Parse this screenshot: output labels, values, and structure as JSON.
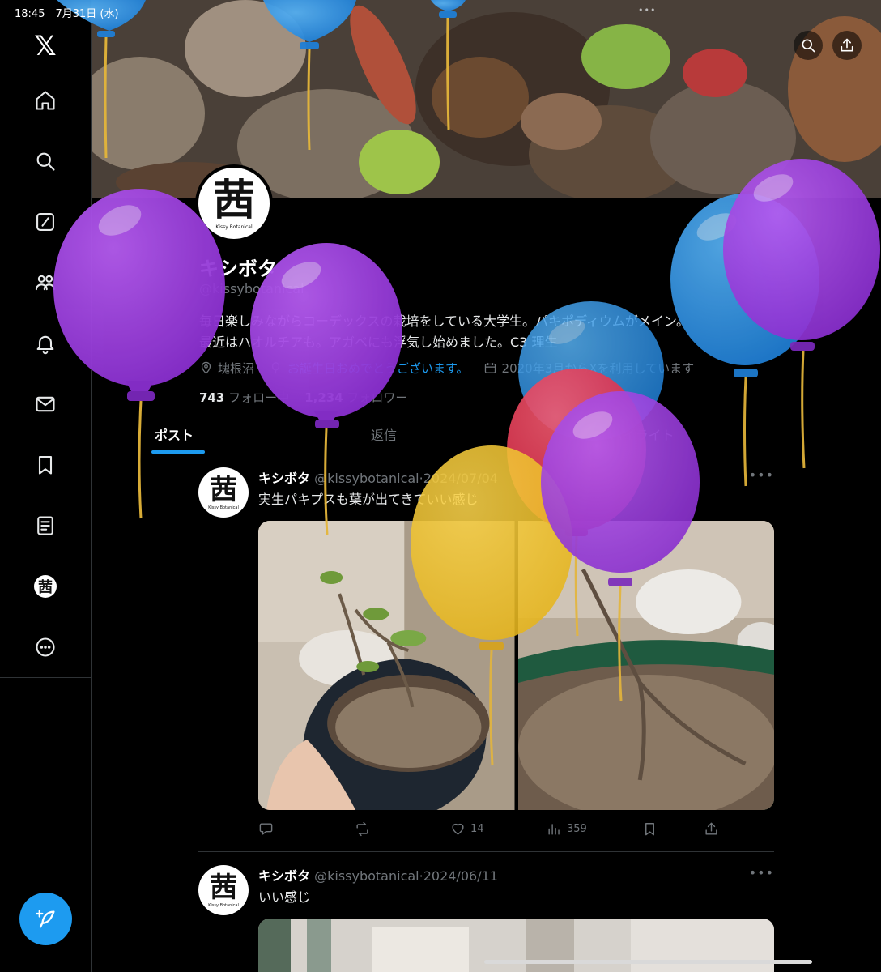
{
  "status_bar": {
    "time": "18:45　7月31日 (水)",
    "dots": "•••"
  },
  "sidebar": {
    "logo": "𝕏",
    "items": [
      {
        "name": "home"
      },
      {
        "name": "search"
      },
      {
        "name": "grok"
      },
      {
        "name": "communities"
      },
      {
        "name": "notifications"
      },
      {
        "name": "messages"
      },
      {
        "name": "bookmarks"
      },
      {
        "name": "lists"
      },
      {
        "name": "profile"
      },
      {
        "name": "more"
      }
    ]
  },
  "profile": {
    "avatar_glyph": "茜",
    "avatar_caption": "Kissy Botanical",
    "display_name": "キシボタ",
    "handle": "@kissybotanical",
    "bio_line1": "毎日楽しみながらコーデックスの栽培をしている大学生。パキポディウムがメイン。",
    "bio_line2": "最近はハオルチアも。アガベにも浮気し始めました。C3 理生",
    "location": "塊根沼",
    "birthday": "お誕生日おめでとうございます。",
    "joined": "2020年3月からXを利用しています",
    "following_count": "743",
    "following_label": "フォロー中",
    "followers_count": "1,234",
    "followers_label": "フォロワー"
  },
  "tabs": [
    {
      "label": "ポスト",
      "active": true
    },
    {
      "label": "返信",
      "active": false
    },
    {
      "label": "ハイライト",
      "active": false
    }
  ],
  "posts": [
    {
      "name": "キシボタ",
      "handle": "@kissybotanical",
      "date": "2024/07/04",
      "text": "実生パキプスも葉が出てきていい感じ",
      "likes": "14",
      "views": "359"
    },
    {
      "name": "キシボタ",
      "handle": "@kissybotanical",
      "date": "2024/06/11",
      "text": "いい感じ"
    }
  ],
  "colors": {
    "accent": "#1d9bf0",
    "balloon_purple": "#9b3fd8",
    "balloon_blue": "#2b8fe0",
    "balloon_yellow": "#f2c22a",
    "balloon_red": "#e8314f"
  }
}
